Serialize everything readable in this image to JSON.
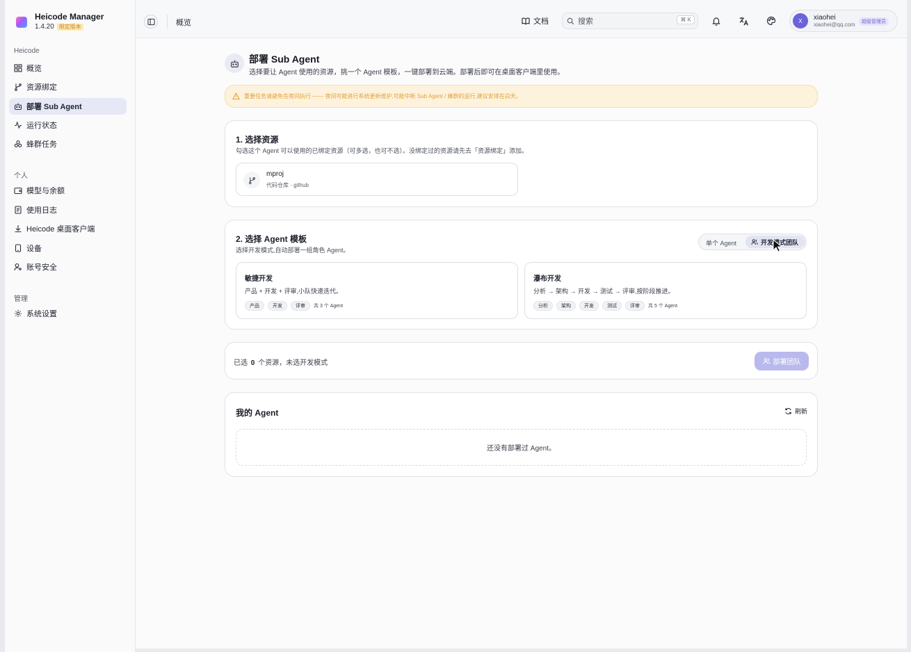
{
  "app": {
    "name": "Heicode Manager",
    "version": "1.4.20",
    "version_badge": "限定版本"
  },
  "sidebar": {
    "sections": [
      {
        "title": "Heicode",
        "items": [
          {
            "label": "概览",
            "icon": "dashboard-icon"
          },
          {
            "label": "资源绑定",
            "icon": "git-branch-icon"
          },
          {
            "label": "部署 Sub Agent",
            "icon": "bot-icon",
            "active": true
          },
          {
            "label": "运行状态",
            "icon": "activity-icon"
          },
          {
            "label": "蜂群任务",
            "icon": "swarm-icon"
          }
        ]
      },
      {
        "title": "个人",
        "items": [
          {
            "label": "模型与余额",
            "icon": "wallet-icon"
          },
          {
            "label": "使用日志",
            "icon": "log-icon"
          },
          {
            "label": "Heicode 桌面客户端",
            "icon": "download-icon"
          },
          {
            "label": "设备",
            "icon": "device-icon"
          },
          {
            "label": "账号安全",
            "icon": "user-key-icon"
          }
        ]
      },
      {
        "title": "管理",
        "items": [
          {
            "label": "系统设置",
            "icon": "gear-icon"
          }
        ]
      }
    ]
  },
  "topbar": {
    "breadcrumb": "概览",
    "docs_label": "文档",
    "search_placeholder": "搜索",
    "search_shortcut": "⌘ K",
    "user": {
      "initial": "X",
      "name": "xiaohei",
      "email": "xiaohei@qq.com",
      "role": "超级管理员"
    }
  },
  "page": {
    "title": "部署 Sub Agent",
    "subtitle": "选择要让 Agent 使用的资源，挑一个 Agent 模板，一键部署到云端。部署后即可在桌面客户端里使用。",
    "warning": "重要任务请避免在夜间执行 —— 夜间可能进行系统更新维护,可能中断 Sub Agent / 蜂群的运行,建议安排在白天。"
  },
  "step1": {
    "title": "1. 选择资源",
    "subtitle": "勾选这个 Agent 可以使用的已绑定资源（可多选，也可不选）。没绑定过的资源请先去「资源绑定」添加。",
    "resources": [
      {
        "name": "mproj",
        "meta": "代码仓库 · github"
      }
    ]
  },
  "step2": {
    "title": "2. 选择 Agent 模板",
    "subtitle": "选择开发模式,自动部署一组角色 Agent。",
    "toggle": {
      "single": "单个 Agent",
      "team": "开发模式团队",
      "selected": "team"
    },
    "templates": [
      {
        "name": "敏捷开发",
        "desc": "产品 + 开发 + 评审,小队快速迭代。",
        "tags": [
          "产品",
          "开发",
          "评审"
        ],
        "count": "共 3 个 Agent"
      },
      {
        "name": "瀑布开发",
        "desc": "分析 → 架构 → 开发 → 测试 → 评审,按阶段推进。",
        "tags": [
          "分析",
          "架构",
          "开发",
          "测试",
          "评审"
        ],
        "count": "共 5 个 Agent"
      }
    ]
  },
  "summary": {
    "prefix": "已选",
    "count": "0",
    "suffix": "个资源，未选开发模式",
    "deploy_label": "部署团队"
  },
  "my_agents": {
    "title": "我的 Agent",
    "refresh_label": "刷新",
    "empty": "还没有部署过 Agent。"
  },
  "colors": {
    "accent": "#6b63d9",
    "warning_bg": "#fdf2dc",
    "warning_text": "#e0a23a",
    "deploy_disabled": "#b9b9ee"
  }
}
